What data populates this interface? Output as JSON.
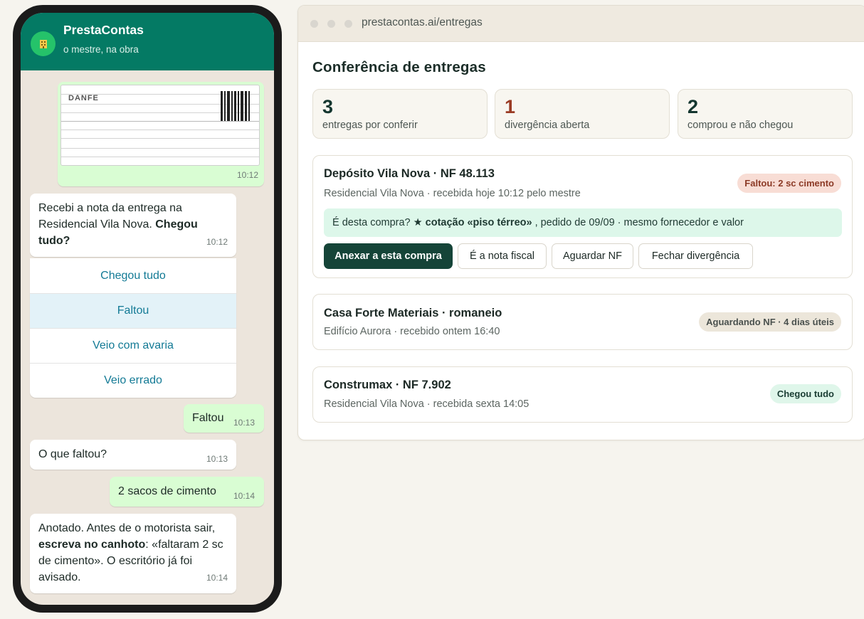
{
  "chat": {
    "contact_name": "PrestaContas",
    "contact_status": "o mestre, na obra",
    "messages": {
      "danfe": {
        "label": "DANFE",
        "time": "10:12"
      },
      "recebi": {
        "text_before": "Recebi a nota da entrega na Residencial Vila Nova. ",
        "text_bold": "Chegou tudo?",
        "time": "10:12"
      },
      "quick_replies": [
        "Chegou tudo",
        "Faltou",
        "Veio com avaria",
        "Veio errado"
      ],
      "faltou": {
        "text": "Faltou",
        "time": "10:13"
      },
      "oque": {
        "text": "O que faltou?",
        "time": "10:13"
      },
      "sacos": {
        "text": "2 sacos de cimento",
        "time": "10:14"
      },
      "anotado": {
        "text_before": "Anotado. Antes de o motorista sair, ",
        "text_bold": "escreva no canhoto",
        "text_after": ": «faltaram 2 sc de cimento». O escritório já foi avisado.",
        "time": "10:14"
      }
    }
  },
  "browser": {
    "url": "prestacontas.ai/entregas",
    "page_title": "Conferência de entregas",
    "stats": [
      {
        "number": "3",
        "label": "entregas por conferir"
      },
      {
        "number": "1",
        "label": "divergência aberta"
      },
      {
        "number": "2",
        "label": "comprou e não chegou"
      }
    ],
    "deliveries": [
      {
        "title": "Depósito Vila Nova · NF 48.113",
        "subtitle": "Residencial Vila Nova · recebida hoje 10:12 pelo mestre",
        "badge": "Faltou: 2 sc cimento",
        "suggestion_before": "É desta compra? ★",
        "suggestion_bold": "cotação «piso térreo»",
        "suggestion_after": ", pedido de 09/09 · mesmo fornecedor e valor",
        "actions": [
          "Anexar a esta compra",
          "É a nota fiscal",
          "Aguardar NF",
          "Fechar divergência"
        ]
      },
      {
        "title": "Casa Forte Materiais · romaneio",
        "subtitle": "Edifício Aurora · recebido ontem 16:40",
        "badge": "Aguardando NF · 4 dias úteis"
      },
      {
        "title": "Construmax · NF 7.902",
        "subtitle": "Residencial Vila Nova · recebida sexta 14:05",
        "badge": "Chegou tudo"
      }
    ]
  },
  "colors": {
    "whatsapp_header": "#047a64",
    "primary_button": "#154438",
    "badge_red": "#f8ddd5",
    "badge_green": "#dff6ea",
    "suggestion_bg": "#ddf7ea"
  },
  "icons": {
    "avatar": "building-icon",
    "suggestion_star": "star-icon"
  }
}
